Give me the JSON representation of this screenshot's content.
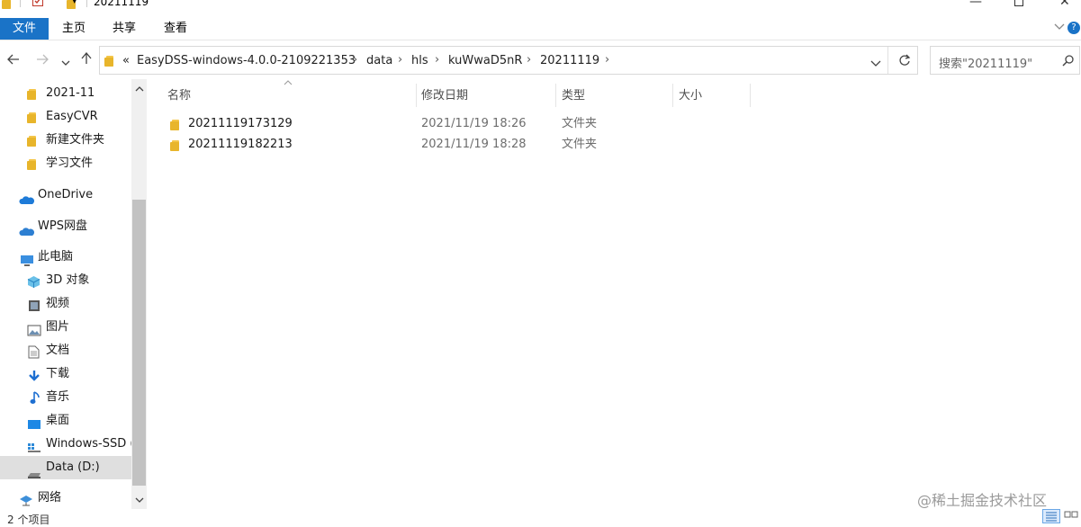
{
  "window": {
    "title": "20211119"
  },
  "ribbon": {
    "tabs": [
      "文件",
      "主页",
      "共享",
      "查看"
    ]
  },
  "address": {
    "overflow_symbol": "«",
    "crumbs": [
      "EasyDSS-windows-4.0.0-2109221353",
      "data",
      "hls",
      "kuWwaD5nR",
      "20211119"
    ],
    "separator": "›"
  },
  "search": {
    "placeholder": "搜索\"20211119\""
  },
  "sidebar": {
    "items": [
      {
        "label": "2021-11",
        "icon": "folder-icon"
      },
      {
        "label": "EasyCVR",
        "icon": "folder-icon"
      },
      {
        "label": "新建文件夹",
        "icon": "folder-icon"
      },
      {
        "label": "学习文件",
        "icon": "folder-icon"
      },
      {
        "label": "OneDrive",
        "icon": "cloud-icon"
      },
      {
        "label": "WPS网盘",
        "icon": "cloud-icon"
      },
      {
        "label": "此电脑",
        "icon": "computer-icon"
      },
      {
        "label": "3D 对象",
        "icon": "3d-objects-icon"
      },
      {
        "label": "视频",
        "icon": "video-icon"
      },
      {
        "label": "图片",
        "icon": "picture-icon"
      },
      {
        "label": "文档",
        "icon": "document-icon"
      },
      {
        "label": "下载",
        "icon": "download-icon"
      },
      {
        "label": "音乐",
        "icon": "music-icon"
      },
      {
        "label": "桌面",
        "icon": "desktop-icon"
      },
      {
        "label": "Windows-SSD (",
        "icon": "drive-icon"
      },
      {
        "label": "Data (D:)",
        "icon": "drive-icon"
      },
      {
        "label": "网络",
        "icon": "network-icon"
      }
    ],
    "selected": "Data (D:)"
  },
  "columns": {
    "name": "名称",
    "date": "修改日期",
    "type": "类型",
    "size": "大小"
  },
  "files": [
    {
      "name": "20211119173129",
      "date": "2021/11/19 18:26",
      "type": "文件夹",
      "size": ""
    },
    {
      "name": "20211119182213",
      "date": "2021/11/19 18:28",
      "type": "文件夹",
      "size": ""
    }
  ],
  "status": {
    "count": "2 个项目"
  },
  "watermark": "@稀土掘金技术社区",
  "colors": {
    "accent": "#1a73c7",
    "folder": "#f4c64a",
    "selection": "#dfdfdf"
  }
}
